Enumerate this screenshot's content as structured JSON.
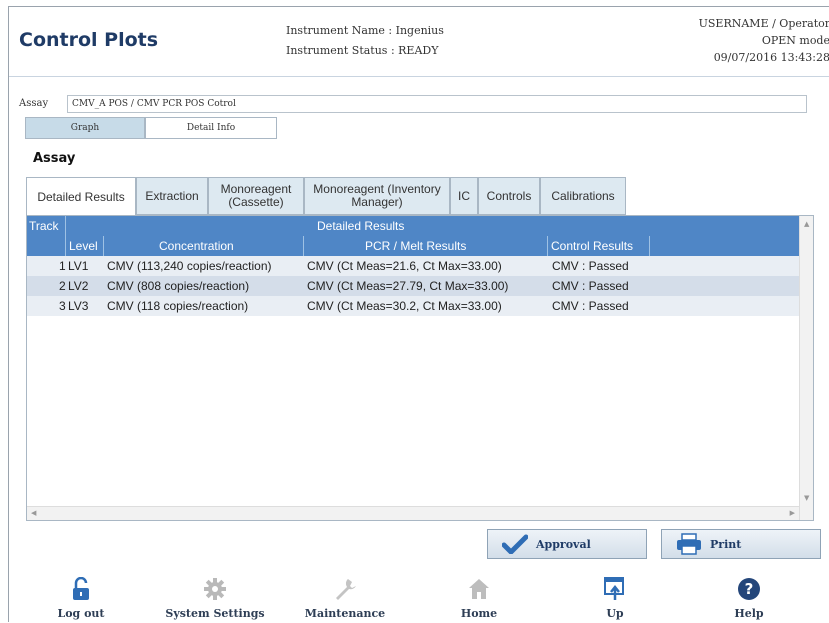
{
  "header": {
    "title": "Control Plots",
    "instrument_name": "Instrument Name : Ingenius",
    "instrument_status": "Instrument Status : READY",
    "user": "USERNAME / Operator",
    "mode": "OPEN mode",
    "datetime": "09/07/2016 13:43:28"
  },
  "assay": {
    "label": "Assay",
    "value": "CMV_A POS / CMV PCR POS Cotrol"
  },
  "view_tabs": [
    {
      "label": "Graph",
      "active": true
    },
    {
      "label": "Detail Info",
      "active": false
    }
  ],
  "section_title": "Assay",
  "tabs": [
    {
      "label": "Detailed Results",
      "active": true
    },
    {
      "label": "Extraction"
    },
    {
      "label": "Monoreagent (Cassette)"
    },
    {
      "label": "Monoreagent (Inventory Manager)"
    },
    {
      "label": "IC"
    },
    {
      "label": "Controls"
    },
    {
      "label": "Calibrations"
    }
  ],
  "table": {
    "group_headers": {
      "track": "Track",
      "detailed": "Detailed Results"
    },
    "columns": [
      "Level",
      "Concentration",
      "PCR / Melt Results",
      "Control Results"
    ],
    "rows": [
      {
        "track": "1",
        "level": "LV1",
        "concentration": "CMV (113,240 copies/reaction)",
        "pcr": "CMV (Ct Meas=21.6, Ct Max=33.00)",
        "control": "CMV : Passed"
      },
      {
        "track": "2",
        "level": "LV2",
        "concentration": "CMV (808 copies/reaction)",
        "pcr": "CMV (Ct Meas=27.79, Ct Max=33.00)",
        "control": "CMV : Passed"
      },
      {
        "track": "3",
        "level": "LV3",
        "concentration": "CMV (118 copies/reaction)",
        "pcr": "CMV (Ct Meas=30.2, Ct Max=33.00)",
        "control": "CMV : Passed"
      }
    ]
  },
  "buttons": {
    "approval": "Approval",
    "print": "Print"
  },
  "footer": [
    {
      "label": "Log out",
      "icon": "lock-open-icon"
    },
    {
      "label": "System Settings",
      "icon": "gear-icon"
    },
    {
      "label": "Maintenance",
      "icon": "wrench-icon"
    },
    {
      "label": "Home",
      "icon": "home-icon"
    },
    {
      "label": "Up",
      "icon": "up-icon"
    },
    {
      "label": "Help",
      "icon": "help-icon"
    }
  ],
  "colors": {
    "accent": "#4f86c6",
    "title": "#1f3b66",
    "approval_check": "#2f6db5"
  }
}
